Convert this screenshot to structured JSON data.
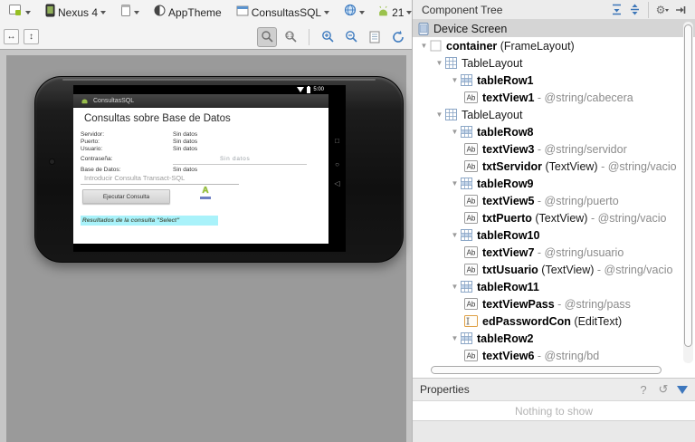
{
  "toolbar": {
    "device": "Nexus 4",
    "theme": "AppTheme",
    "activity": "ConsultasSQL",
    "api_level": "21"
  },
  "phone": {
    "status_time": "5:00",
    "app_title": "ConsultasSQL",
    "heading": "Consultas sobre Base de Datos",
    "rows": [
      {
        "label": "Servidor:",
        "value": "Sin datos"
      },
      {
        "label": "Puerto:",
        "value": "Sin datos"
      },
      {
        "label": "Usuario:",
        "value": "Sin datos"
      },
      {
        "label": "Contraseña:",
        "value": "Sin datos",
        "hint": true
      },
      {
        "label": "Base de Datos:",
        "value": "Sin datos"
      }
    ],
    "query_hint": "Introducir Consulta Transact-SQL",
    "execute_button": "Ejecutar Consulta",
    "results_text": "Resultados de la consulta \"Select\""
  },
  "component_tree": {
    "title": "Component Tree",
    "nodes": [
      {
        "indent": 0,
        "arrow": false,
        "icon": "device",
        "plain": "Device Screen",
        "selected": true
      },
      {
        "indent": 0,
        "arrow": true,
        "icon": "frame",
        "bold": "container",
        "type": "FrameLayout"
      },
      {
        "indent": 1,
        "arrow": true,
        "icon": "table",
        "plain": "TableLayout"
      },
      {
        "indent": 2,
        "arrow": true,
        "icon": "tablerow",
        "bold": "tableRow1"
      },
      {
        "indent": 3,
        "arrow": false,
        "icon": "ab",
        "bold": "textView1",
        "res": "@string/cabecera"
      },
      {
        "indent": 1,
        "arrow": true,
        "icon": "table",
        "plain": "TableLayout"
      },
      {
        "indent": 2,
        "arrow": true,
        "icon": "tablerow",
        "bold": "tableRow8"
      },
      {
        "indent": 3,
        "arrow": false,
        "icon": "ab",
        "bold": "textView3",
        "res": "@string/servidor"
      },
      {
        "indent": 3,
        "arrow": false,
        "icon": "ab",
        "bold": "txtServidor",
        "type": "TextView",
        "res": "@string/vacio"
      },
      {
        "indent": 2,
        "arrow": true,
        "icon": "tablerow",
        "bold": "tableRow9"
      },
      {
        "indent": 3,
        "arrow": false,
        "icon": "ab",
        "bold": "textView5",
        "res": "@string/puerto"
      },
      {
        "indent": 3,
        "arrow": false,
        "icon": "ab",
        "bold": "txtPuerto",
        "type": "TextView",
        "res": "@string/vacio"
      },
      {
        "indent": 2,
        "arrow": true,
        "icon": "tablerow",
        "bold": "tableRow10"
      },
      {
        "indent": 3,
        "arrow": false,
        "icon": "ab",
        "bold": "textView7",
        "res": "@string/usuario"
      },
      {
        "indent": 3,
        "arrow": false,
        "icon": "ab",
        "bold": "txtUsuario",
        "type": "TextView",
        "res": "@string/vacio"
      },
      {
        "indent": 2,
        "arrow": true,
        "icon": "tablerow",
        "bold": "tableRow11"
      },
      {
        "indent": 3,
        "arrow": false,
        "icon": "ab",
        "bold": "textViewPass",
        "res": "@string/pass"
      },
      {
        "indent": 3,
        "arrow": false,
        "icon": "edittext",
        "bold": "edPasswordCon",
        "type": "EditText"
      },
      {
        "indent": 2,
        "arrow": true,
        "icon": "tablerow",
        "bold": "tableRow2"
      },
      {
        "indent": 3,
        "arrow": false,
        "icon": "ab",
        "bold": "textView6",
        "res": "@string/bd"
      }
    ]
  },
  "properties": {
    "title": "Properties",
    "empty_text": "Nothing to show"
  },
  "colors": {
    "android_green": "#9bc24d",
    "results_highlight": "#a9f2fa",
    "selection_gray": "#d5d5d5",
    "accent_blue": "#3c76b8"
  }
}
